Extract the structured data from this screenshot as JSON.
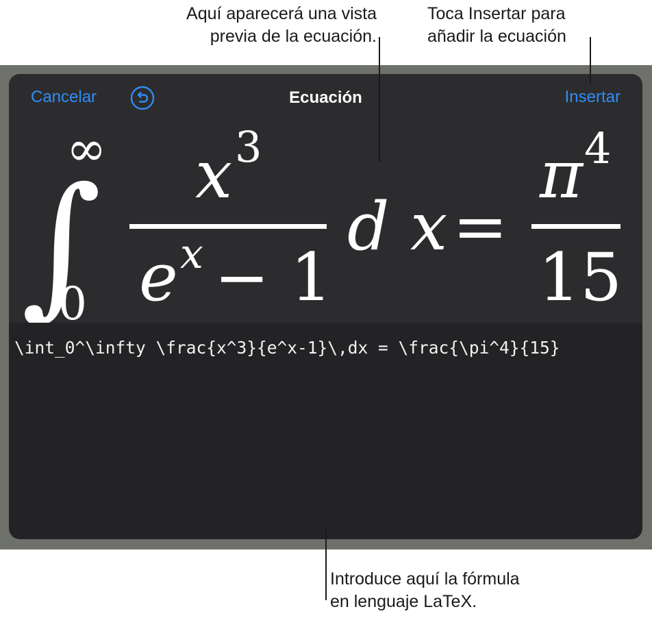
{
  "callouts": {
    "preview": [
      "Aquí aparecerá una vista",
      "previa de la ecuación."
    ],
    "insert": [
      "Toca Insertar para",
      "añadir la ecuación"
    ],
    "latex": [
      "Introduce aquí la fórmula",
      "en lenguaje LaTeX."
    ]
  },
  "toolbar": {
    "cancel_label": "Cancelar",
    "title": "Ecuación",
    "insert_label": "Insertar",
    "undo_icon": "undo-icon"
  },
  "equation": {
    "integral_sign": "∫",
    "upper_limit": "∞",
    "lower_limit": "0",
    "numerator_base": "x",
    "numerator_exp": "3",
    "denominator_base": "e",
    "denominator_exp": "x",
    "denominator_rest": "− 1",
    "differential": "d x",
    "equals": "=",
    "rhs_numerator_base": "π",
    "rhs_numerator_exp": "4",
    "rhs_denominator": "15"
  },
  "latex_source": "\\int_0^\\infty \\frac{x^3}{e^x-1}\\,dx = \\frac{\\pi^4}{15}",
  "colors": {
    "accent": "#2f8cf6",
    "frame": "#6e706b",
    "preview_bg": "#2c2c2e",
    "editor_bg": "#232325"
  }
}
